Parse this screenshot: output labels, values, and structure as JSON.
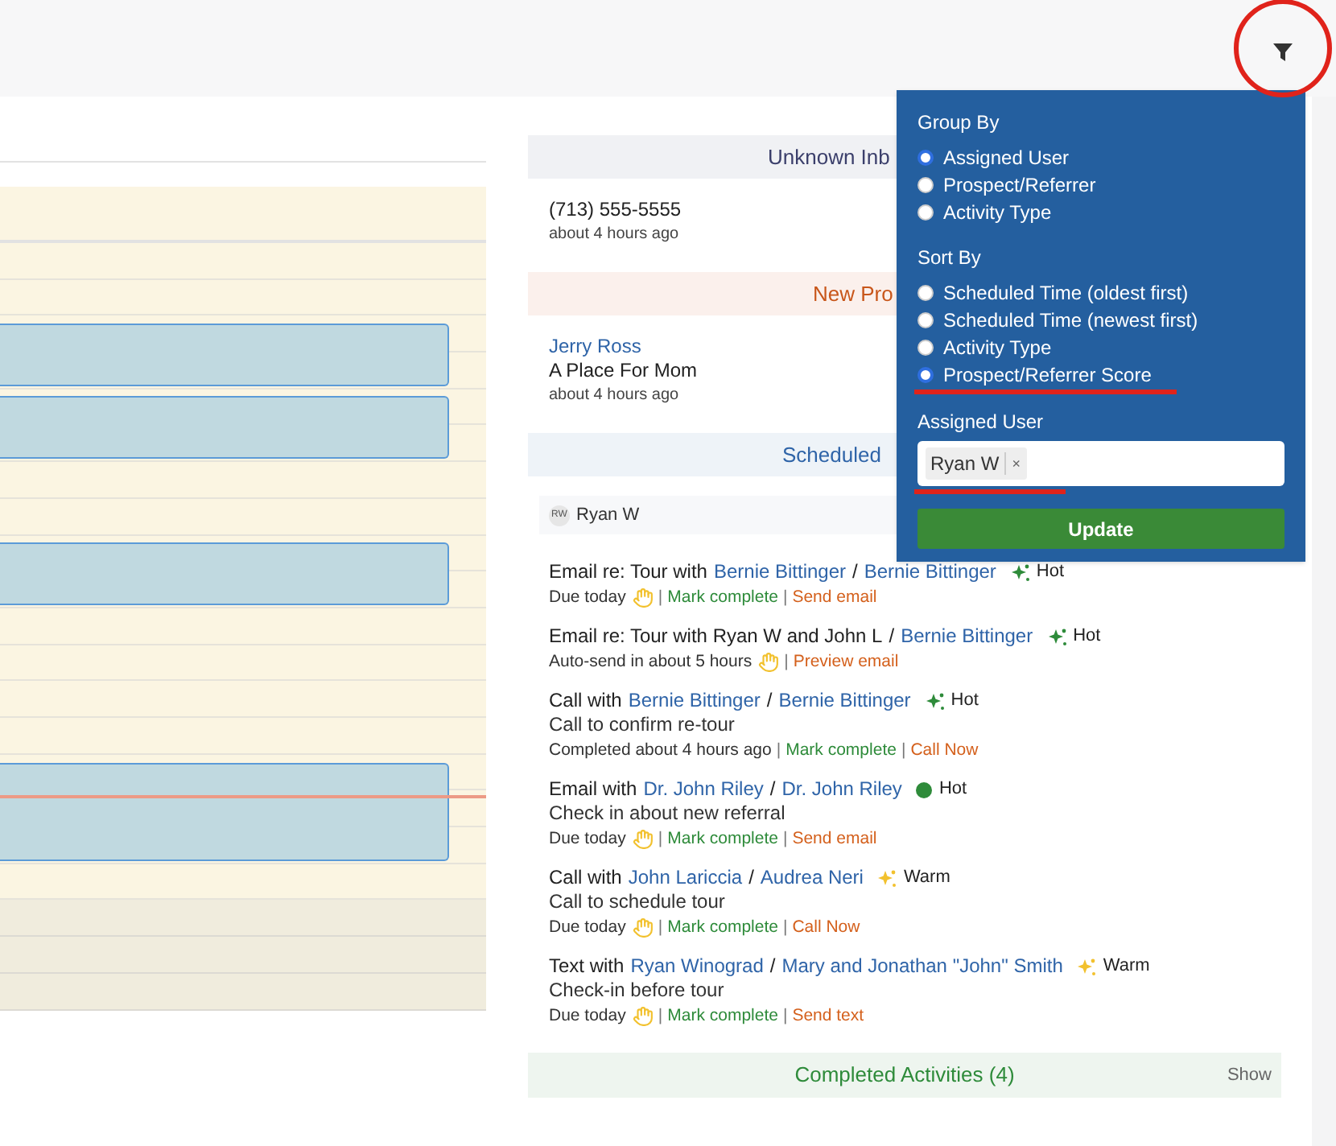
{
  "sections": [
    {
      "kind": "unknown",
      "title": "Unknown Inb",
      "items": [
        {
          "primary": "(713) 555-5555",
          "time": "about 4 hours ago"
        }
      ]
    },
    {
      "kind": "new",
      "title": "New Pro",
      "items": [
        {
          "link": "Jerry Ross",
          "primary": "A Place For Mom",
          "time": "about 4 hours ago"
        }
      ]
    },
    {
      "kind": "scheduled",
      "title": "Scheduled"
    }
  ],
  "group": {
    "initials": "RW",
    "name": "Ryan W"
  },
  "activities": [
    {
      "parts": [
        {
          "kind": "plain",
          "text": "Email re: Tour with"
        },
        {
          "kind": "link",
          "text": "Bernie Bittinger"
        },
        {
          "kind": "plain",
          "text": "/"
        },
        {
          "kind": "link",
          "text": "Bernie Bittinger"
        }
      ],
      "score": {
        "kind": "sparkle",
        "color": "#2e8b3a",
        "label": "Hot"
      },
      "meta": "Due today",
      "hand": true,
      "actions": [
        {
          "kind": "complete",
          "label": "Mark complete",
          "sep": "|"
        },
        {
          "kind": "primary",
          "label": "Send email",
          "sep": "|"
        }
      ]
    },
    {
      "parts": [
        {
          "kind": "plain",
          "text": "Email re: Tour with Ryan W and John L"
        },
        {
          "kind": "plain",
          "text": "/"
        },
        {
          "kind": "link",
          "text": "Bernie Bittinger"
        }
      ],
      "score": {
        "kind": "sparkle",
        "color": "#2e8b3a",
        "label": "Hot"
      },
      "meta": "Auto-send in about 5 hours",
      "hand": true,
      "actions": [
        {
          "kind": "primary",
          "label": "Preview email",
          "sep": "|"
        }
      ]
    },
    {
      "parts": [
        {
          "kind": "plain",
          "text": "Call with"
        },
        {
          "kind": "link",
          "text": "Bernie Bittinger"
        },
        {
          "kind": "plain",
          "text": "/"
        },
        {
          "kind": "link",
          "text": "Bernie Bittinger"
        }
      ],
      "score": {
        "kind": "sparkle",
        "color": "#2e8b3a",
        "label": "Hot"
      },
      "note": "Call to confirm re-tour",
      "meta": "Completed about 4 hours ago",
      "hand": false,
      "actions": [
        {
          "kind": "complete",
          "label": "Mark complete",
          "sep": "|"
        },
        {
          "kind": "primary",
          "label": "Call Now",
          "sep": "|"
        }
      ]
    },
    {
      "parts": [
        {
          "kind": "plain",
          "text": "Email with"
        },
        {
          "kind": "link",
          "text": "Dr. John Riley"
        },
        {
          "kind": "plain",
          "text": "/"
        },
        {
          "kind": "link",
          "text": "Dr. John Riley"
        }
      ],
      "score": {
        "kind": "dot",
        "color": "#2e8b3a",
        "label": "Hot"
      },
      "note": "Check in about new referral",
      "meta": "Due today",
      "hand": true,
      "actions": [
        {
          "kind": "complete",
          "label": "Mark complete",
          "sep": "|"
        },
        {
          "kind": "primary",
          "label": "Send email",
          "sep": "|"
        }
      ]
    },
    {
      "parts": [
        {
          "kind": "plain",
          "text": "Call with"
        },
        {
          "kind": "link",
          "text": "John Lariccia"
        },
        {
          "kind": "plain",
          "text": "/"
        },
        {
          "kind": "link",
          "text": "Audrea Neri"
        }
      ],
      "score": {
        "kind": "sparkle",
        "color": "#f2c12e",
        "label": "Warm"
      },
      "note": "Call to schedule tour",
      "meta": "Due today",
      "hand": true,
      "actions": [
        {
          "kind": "complete",
          "label": "Mark complete",
          "sep": "|"
        },
        {
          "kind": "primary",
          "label": "Call Now",
          "sep": "|"
        }
      ]
    },
    {
      "parts": [
        {
          "kind": "plain",
          "text": "Text with"
        },
        {
          "kind": "link",
          "text": "Ryan Winograd"
        },
        {
          "kind": "plain",
          "text": "/"
        },
        {
          "kind": "link",
          "text": "Mary and Jonathan \"John\" Smith"
        }
      ],
      "score": {
        "kind": "sparkle",
        "color": "#f2c12e",
        "label": "Warm"
      },
      "note": "Check-in before tour",
      "meta": "Due today",
      "hand": true,
      "actions": [
        {
          "kind": "complete",
          "label": "Mark complete",
          "sep": "|"
        },
        {
          "kind": "primary",
          "label": "Send text",
          "sep": "|"
        }
      ]
    }
  ],
  "completed": {
    "title": "Completed Activities (4)",
    "toggle": "Show"
  },
  "filter": {
    "groups": [
      {
        "title": "Group By",
        "options": [
          {
            "label": "Assigned User",
            "selected": true
          },
          {
            "label": "Prospect/Referrer",
            "selected": false
          },
          {
            "label": "Activity Type",
            "selected": false
          }
        ]
      },
      {
        "title": "Sort By",
        "options": [
          {
            "label": "Scheduled Time (oldest first)",
            "selected": false
          },
          {
            "label": "Scheduled Time (newest first)",
            "selected": false
          },
          {
            "label": "Activity Type",
            "selected": false
          },
          {
            "label": "Prospect/Referrer Score",
            "selected": true
          }
        ]
      }
    ],
    "user_label": "Assigned User",
    "chips": [
      {
        "label": "Ryan W",
        "remove": "×"
      }
    ],
    "button": "Update"
  }
}
